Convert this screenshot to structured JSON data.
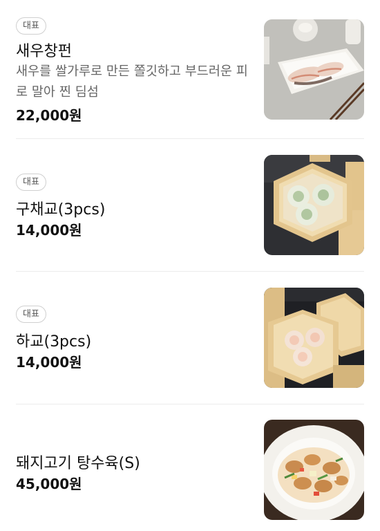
{
  "menu": {
    "items": [
      {
        "badge": "대표",
        "name": "새우창펀",
        "description": "새우를 쌀가루로 만든 쫄깃하고 부드러운 피로 말아 찐 딤섬",
        "price": "22,000원",
        "image": "shrimp-rice-roll-photo"
      },
      {
        "badge": "대표",
        "name": "구채교(3pcs)",
        "price": "14,000원",
        "image": "chive-dumpling-steamer-photo"
      },
      {
        "badge": "대표",
        "name": "하교(3pcs)",
        "price": "14,000원",
        "image": "har-gow-steamer-photo"
      },
      {
        "name": "돼지고기 탕수육(S)",
        "price": "45,000원",
        "image": "sweet-sour-pork-photo"
      }
    ]
  }
}
